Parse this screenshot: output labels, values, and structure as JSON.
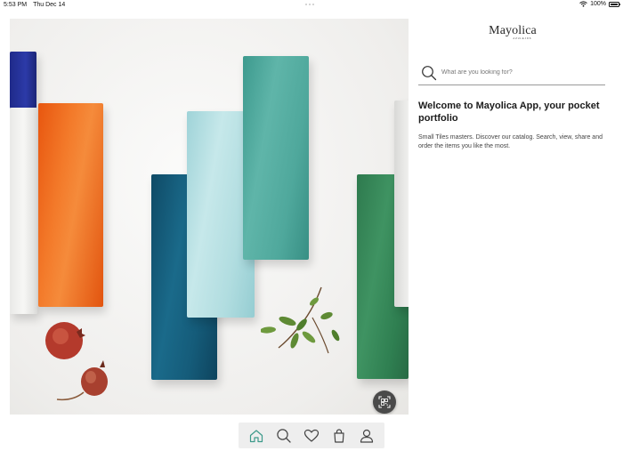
{
  "status_bar": {
    "time": "5:53 PM",
    "date": "Thu Dec 14",
    "battery": "100%"
  },
  "hero": {
    "image_icon": "tiles-photo",
    "qr_icon": "qr-scan-icon"
  },
  "brand": {
    "name": "Mayolica",
    "sub": "AZULEJOS"
  },
  "search": {
    "placeholder": "What are you looking for?",
    "value": ""
  },
  "welcome": {
    "title": "Welcome to Mayolica App, your pocket portfolio",
    "text": "Small Tiles masters. Discover our catalog. Search, view, share and order the items you like the most."
  },
  "tab_bar": {
    "tabs": [
      {
        "icon": "home-icon",
        "active": true
      },
      {
        "icon": "search-icon",
        "active": false
      },
      {
        "icon": "heart-icon",
        "active": false
      },
      {
        "icon": "bag-icon",
        "active": false
      },
      {
        "icon": "user-icon",
        "active": false
      }
    ]
  },
  "colors": {
    "accent": "#3d9a8b",
    "icon": "#444444",
    "tab_bar_bg": "#eeeeee"
  }
}
